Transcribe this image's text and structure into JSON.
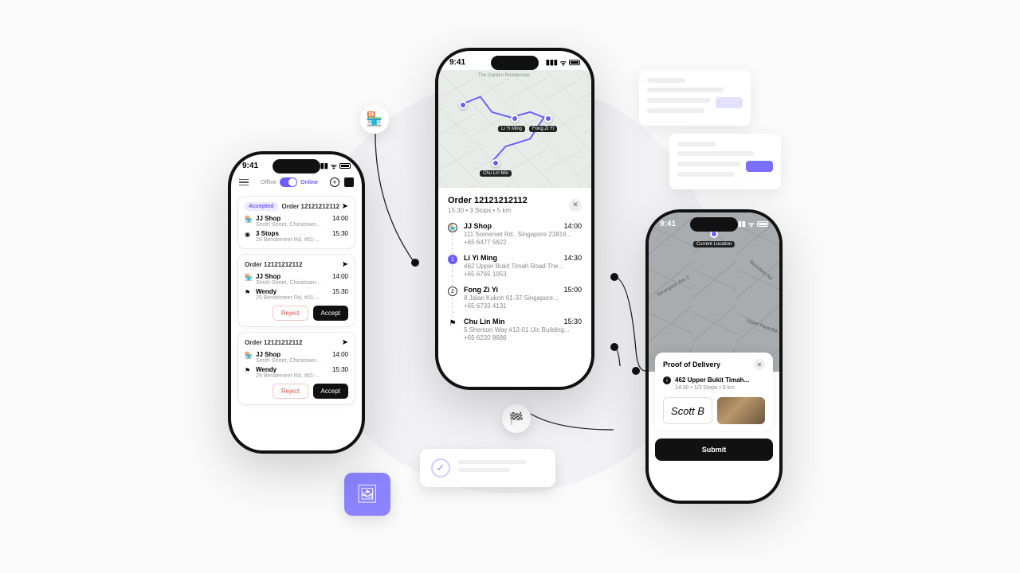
{
  "status_time": "9:41",
  "phone1": {
    "toggle": {
      "off": "Offline",
      "on": "Online"
    },
    "card1": {
      "badge": "Accepted",
      "title": "Order 12121212112",
      "shop": {
        "name": "JJ Shop",
        "addr": "Smith Street, Chinatown...",
        "time": "14:00"
      },
      "dest": {
        "name": "3 Stops",
        "addr": "29 Bendemeer Rd, #01-...",
        "time": "15:30"
      }
    },
    "card2": {
      "title": "Order 12121212112",
      "shop": {
        "name": "JJ Shop",
        "addr": "Smith Street, Chinatown...",
        "time": "14:00"
      },
      "dest": {
        "name": "Wendy",
        "addr": "29 Bendemeer Rd, #01-...",
        "time": "15:30"
      },
      "reject": "Reject",
      "accept": "Accept"
    },
    "card3": {
      "title": "Order 12121212112",
      "shop": {
        "name": "JJ Shop",
        "addr": "Smith Street, Chinatown...",
        "time": "14:00"
      },
      "dest": {
        "name": "Wendy",
        "addr": "29 Bendemeer Rd, #01-...",
        "time": "15:30"
      },
      "reject": "Reject",
      "accept": "Accept"
    }
  },
  "phone2": {
    "map_area": "The Garden Residences",
    "title": "Order 12121212112",
    "sub": "15:30   •   3 Stops   •   5 km",
    "stops": [
      {
        "name": "JJ Shop",
        "addr": "111 Somerset Rd., Singapore 23816...",
        "phone": "+65 6477 5622",
        "time": "14:00"
      },
      {
        "name": "Li Yi Ming",
        "addr": "462 Upper Bukit Timah Road The...",
        "phone": "+65 6765 1053",
        "time": "14:30"
      },
      {
        "name": "Fong Zi Yi",
        "addr": "8 Jalan Kukoh 01-37 Singapore...",
        "phone": "+65 6733 4131",
        "time": "15:00"
      },
      {
        "name": "Chu Lin Min",
        "addr": "5 Shenton Way #13-01 Uic Building...",
        "phone": "+65 6220 8686",
        "time": "15:30"
      }
    ]
  },
  "phone3": {
    "pin_label": "Current Location",
    "roads": {
      "r1": "Serangoon Ave 2",
      "r2": "Boundary Rd",
      "r3": "Upper Paya Rd"
    },
    "card_title": "Proof of Delivery",
    "address": "462 Upper Bukit Timah...",
    "sub": "14:30   •   1/3 Stops   •   5 km",
    "signature": "Scott B",
    "submit": "Submit"
  }
}
